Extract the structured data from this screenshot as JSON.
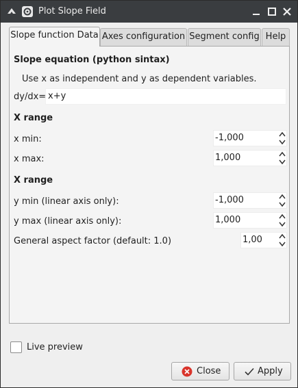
{
  "window": {
    "title": "Plot Slope Field"
  },
  "tabs": [
    {
      "label": "Slope function Data"
    },
    {
      "label": "Axes configuration"
    },
    {
      "label": "Segment config"
    },
    {
      "label": "Help"
    }
  ],
  "slope": {
    "heading": "Slope equation (python sintax)",
    "hint": "Use x as independent and y as dependent variables.",
    "prefix": "dy/dx=",
    "value": "x+y"
  },
  "x_range": {
    "heading": "X range",
    "min_label": "x min:",
    "min_value": "-1,000",
    "max_label": "x max:",
    "max_value": "1,000"
  },
  "y_range": {
    "heading": "X range",
    "min_label": "y min (linear axis only):",
    "min_value": "-1,000",
    "max_label": "y max (linear axis only):",
    "max_value": "1,000",
    "aspect_label": "General aspect factor (default: 1.0)",
    "aspect_value": "1,00"
  },
  "live_preview": {
    "label": "Live preview",
    "checked": false
  },
  "buttons": {
    "close": "Close",
    "apply": "Apply"
  },
  "colors": {
    "titlebar": "#3a3d40",
    "close_icon": "#d9342b"
  }
}
